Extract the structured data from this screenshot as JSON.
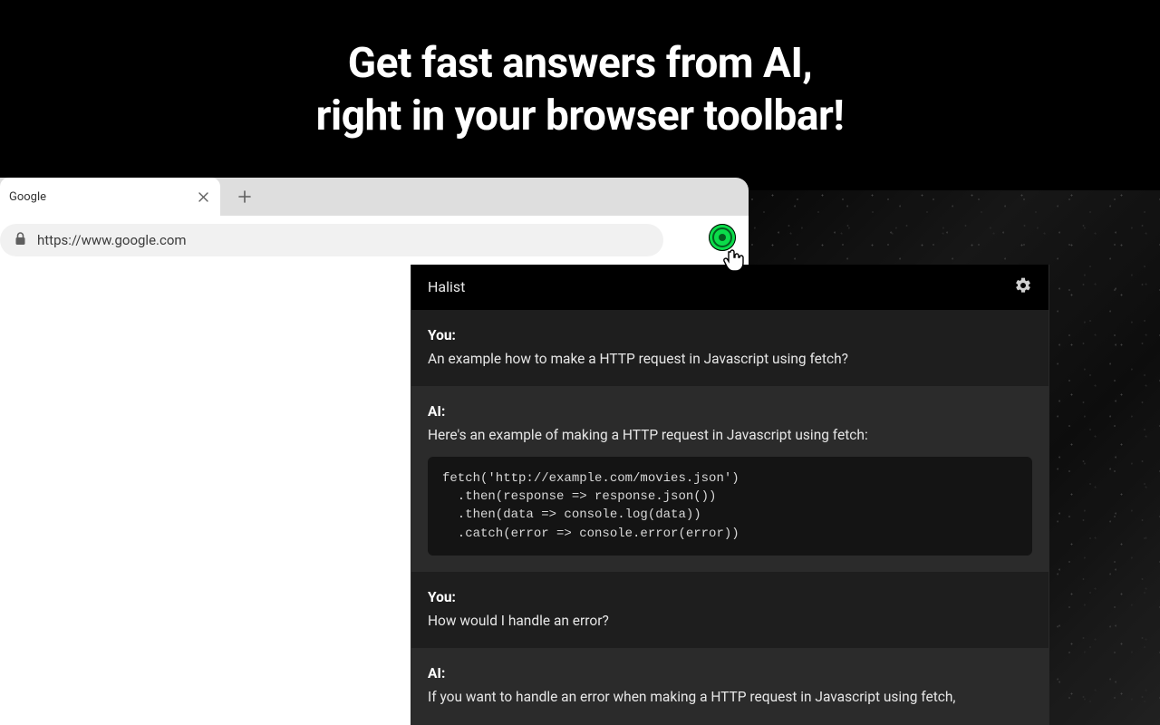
{
  "hero": {
    "line1": "Get fast answers from AI,",
    "line2": "right in your browser toolbar!"
  },
  "browser": {
    "tab_title": "Google",
    "url": "https://www.google.com"
  },
  "popup": {
    "title": "Halist",
    "messages": [
      {
        "sender": "You:",
        "text": "An example how to make a HTTP request in Javascript using fetch?"
      },
      {
        "sender": "AI:",
        "text": "Here's an example of making a HTTP request in Javascript using fetch:",
        "code": "fetch('http://example.com/movies.json')\n  .then(response => response.json())\n  .then(data => console.log(data))\n  .catch(error => console.error(error))"
      },
      {
        "sender": "You:",
        "text": "How would I handle an error?"
      },
      {
        "sender": "AI:",
        "text": "If you want to handle an error when making a HTTP request in Javascript using fetch,"
      }
    ]
  }
}
